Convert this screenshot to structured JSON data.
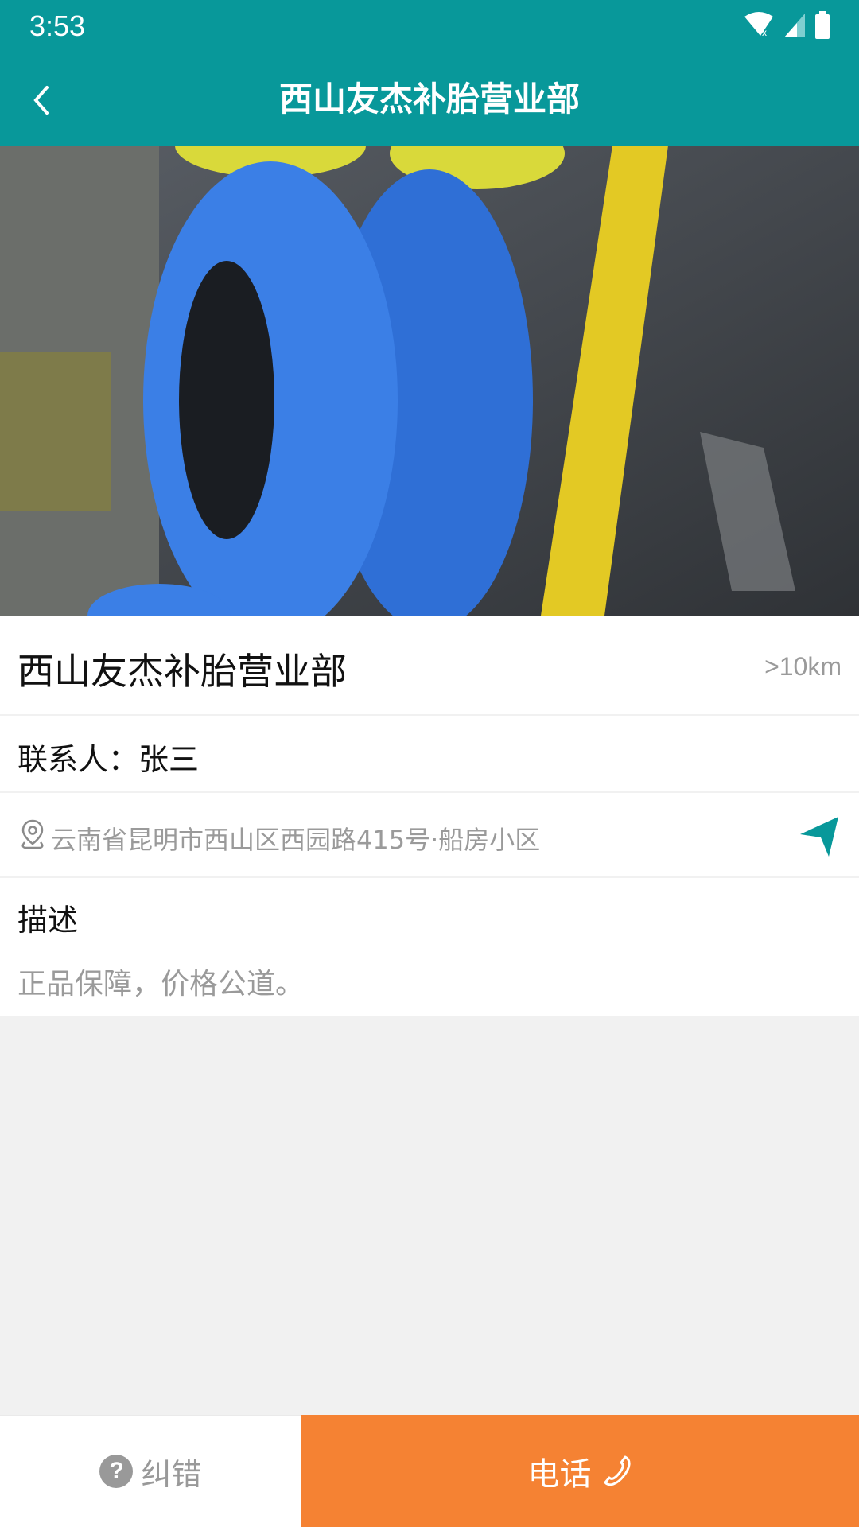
{
  "status_bar": {
    "time": "3:53",
    "icons": [
      "wifi-off-icon",
      "signal-icon",
      "battery-icon"
    ]
  },
  "app_bar": {
    "title": "西山友杰补胎营业部",
    "back_icon": "chevron-left-icon"
  },
  "hero_image": {
    "description": "blue and yellow tires stacked on a floor"
  },
  "shop": {
    "name": "西山友杰补胎营业部",
    "distance": ">10km",
    "contact": "联系人：张三",
    "address": "云南省昆明市西山区西园路415号·船房小区",
    "description_label": "描述",
    "description": "正品保障，价格公道。"
  },
  "bottom_bar": {
    "report_label": "纠错",
    "report_icon": "help-icon",
    "call_label": "电话",
    "call_icon": "phone-icon"
  },
  "colors": {
    "primary": "#08989a",
    "accent": "#f58233",
    "muted_text": "#9a9a9a"
  }
}
